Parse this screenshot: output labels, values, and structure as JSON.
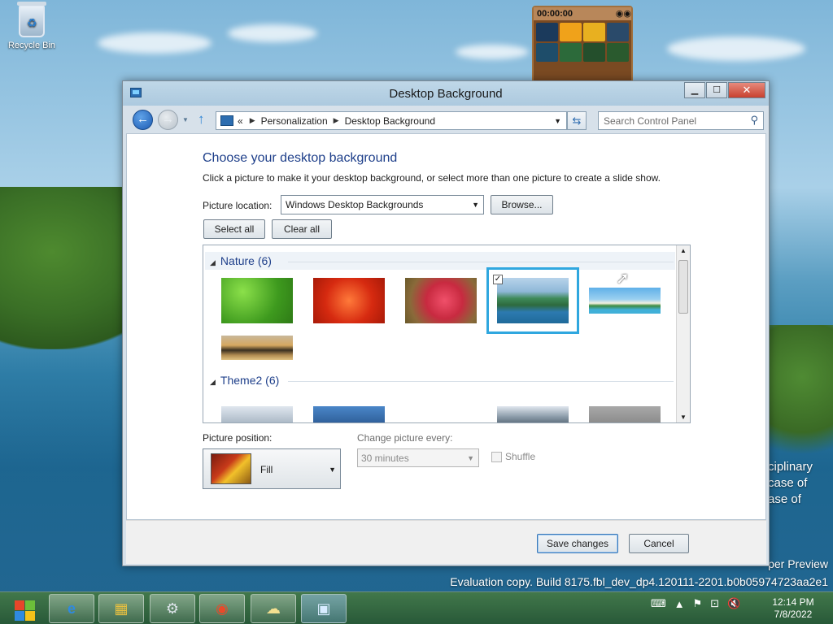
{
  "desktop": {
    "recycle_bin_label": "Recycle Bin",
    "gadget_timer": "00:00:00",
    "watermark_side_lines": [
      "ciplinary",
      "case of",
      "ase of"
    ],
    "watermark_preview": "per Preview",
    "watermark_build": "Evaluation copy. Build 8175.fbl_dev_dp4.120111-2201.b0b05974723aa2e1"
  },
  "window": {
    "title": "Desktop Background",
    "min_label": "▁",
    "max_label": "☐",
    "close_label": "✕"
  },
  "nav": {
    "breadcrumb_prefix": "«",
    "breadcrumb": [
      "Personalization",
      "Desktop Background"
    ],
    "search_placeholder": "Search Control Panel"
  },
  "main": {
    "heading": "Choose your desktop background",
    "subtext": "Click a picture to make it your desktop background, or select more than one picture to create a slide show.",
    "picture_location_label": "Picture location:",
    "picture_location_value": "Windows Desktop Backgrounds",
    "browse_label": "Browse...",
    "select_all_label": "Select all",
    "clear_all_label": "Clear all"
  },
  "gallery": {
    "groups": [
      {
        "name": "Nature (6)",
        "count": 6
      },
      {
        "name": "Theme2 (6)",
        "count": 6
      }
    ],
    "selected_index": 3,
    "nature_thumbs": [
      "green-clover",
      "red-flowers",
      "pink-daisy",
      "island-aerial",
      "beach-island",
      "sunset-coast"
    ],
    "theme2_thumbs": [
      "cloud-sky",
      "blue-sky",
      "coastline",
      "gray-mist"
    ]
  },
  "position": {
    "label": "Picture position:",
    "value": "Fill"
  },
  "slideshow": {
    "change_label": "Change picture every:",
    "change_value": "30 minutes",
    "shuffle_label": "Shuffle",
    "shuffle_checked": false
  },
  "footer": {
    "save_label": "Save changes",
    "cancel_label": "Cancel"
  },
  "taskbar": {
    "items": [
      "internet-explorer",
      "file-explorer",
      "control-panel-device",
      "chrome",
      "messenger",
      "remote-desktop"
    ],
    "clock_time": "12:14 PM",
    "clock_date": "7/8/2022"
  },
  "colors": {
    "accent": "#2fa7df",
    "heading": "#1e3f8a",
    "taskbar": "#3b6e3a"
  }
}
